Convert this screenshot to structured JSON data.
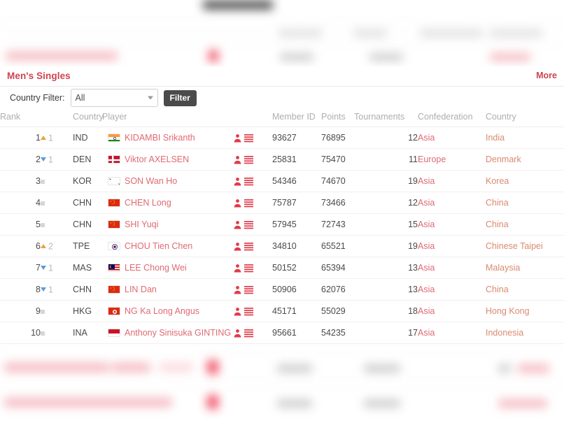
{
  "panel": {
    "title": "Men's Singles",
    "more_label": "More"
  },
  "filter": {
    "label": "Country Filter:",
    "selected": "All",
    "button_label": "Filter",
    "caret_icon": "chevron-down-icon"
  },
  "table": {
    "headers": {
      "rank": "Rank",
      "country": "Country",
      "player": "Player",
      "member_id": "Member ID",
      "points": "Points",
      "tournaments": "Tournaments",
      "confederation": "Confederation",
      "country_name": "Country"
    },
    "row_icons": {
      "profile": "person-profile-icon",
      "details": "list-lines-icon"
    },
    "rows": [
      {
        "rank": "1",
        "move_dir": "up",
        "move_val": "1",
        "country_code": "IND",
        "flag": "india-flag",
        "player": "KIDAMBI Srikanth",
        "member_id": "93627",
        "points": "76895",
        "tournaments": "12",
        "confederation": "Asia",
        "country_name": "India"
      },
      {
        "rank": "2",
        "move_dir": "down",
        "move_val": "1",
        "country_code": "DEN",
        "flag": "denmark-flag",
        "player": "Viktor AXELSEN",
        "member_id": "25831",
        "points": "75470",
        "tournaments": "11",
        "confederation": "Europe",
        "country_name": "Denmark"
      },
      {
        "rank": "3",
        "move_dir": "flat",
        "move_val": "",
        "country_code": "KOR",
        "flag": "korea-flag",
        "player": "SON Wan Ho",
        "member_id": "54346",
        "points": "74670",
        "tournaments": "19",
        "confederation": "Asia",
        "country_name": "Korea"
      },
      {
        "rank": "4",
        "move_dir": "flat",
        "move_val": "",
        "country_code": "CHN",
        "flag": "china-flag",
        "player": "CHEN Long",
        "member_id": "75787",
        "points": "73466",
        "tournaments": "12",
        "confederation": "Asia",
        "country_name": "China"
      },
      {
        "rank": "5",
        "move_dir": "flat",
        "move_val": "",
        "country_code": "CHN",
        "flag": "china-flag",
        "player": "SHI Yuqi",
        "member_id": "57945",
        "points": "72743",
        "tournaments": "15",
        "confederation": "Asia",
        "country_name": "China"
      },
      {
        "rank": "6",
        "move_dir": "up",
        "move_val": "2",
        "country_code": "TPE",
        "flag": "chinese-taipei-flag",
        "player": "CHOU Tien Chen",
        "member_id": "34810",
        "points": "65521",
        "tournaments": "19",
        "confederation": "Asia",
        "country_name": "Chinese Taipei"
      },
      {
        "rank": "7",
        "move_dir": "down",
        "move_val": "1",
        "country_code": "MAS",
        "flag": "malaysia-flag",
        "player": "LEE Chong Wei",
        "member_id": "50152",
        "points": "65394",
        "tournaments": "13",
        "confederation": "Asia",
        "country_name": "Malaysia"
      },
      {
        "rank": "8",
        "move_dir": "down",
        "move_val": "1",
        "country_code": "CHN",
        "flag": "china-flag",
        "player": "LIN Dan",
        "member_id": "50906",
        "points": "62076",
        "tournaments": "13",
        "confederation": "Asia",
        "country_name": "China"
      },
      {
        "rank": "9",
        "move_dir": "flat",
        "move_val": "",
        "country_code": "HKG",
        "flag": "hong-kong-flag",
        "player": "NG Ka Long Angus",
        "member_id": "45171",
        "points": "55029",
        "tournaments": "18",
        "confederation": "Asia",
        "country_name": "Hong Kong"
      },
      {
        "rank": "10",
        "move_dir": "flat",
        "move_val": "",
        "country_code": "INA",
        "flag": "indonesia-flag",
        "player": "Anthony Sinisuka GINTING",
        "member_id": "95661",
        "points": "54235",
        "tournaments": "17",
        "confederation": "Asia",
        "country_name": "Indonesia"
      }
    ]
  },
  "colors": {
    "accent_red": "#d0434f",
    "link_red": "#e06a72",
    "confederation_link": "#de6b73",
    "country_link": "#d98a70",
    "arrow_up": "#e8a33d",
    "arrow_down": "#5b9bd5",
    "button_dark": "#4b4b4b"
  }
}
